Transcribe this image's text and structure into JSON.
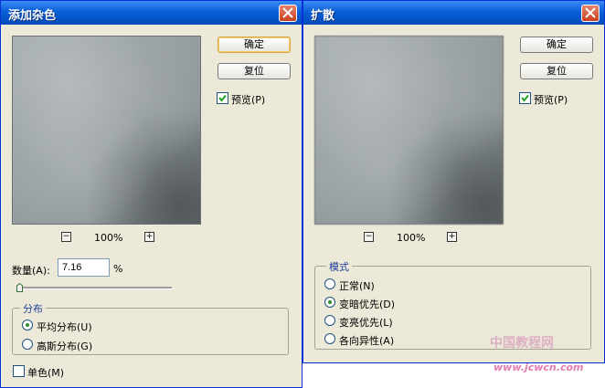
{
  "dialog1": {
    "title": "添加杂色",
    "buttons": {
      "ok": "确定",
      "reset": "复位"
    },
    "preview_label": "预览(P)",
    "preview_checked": true,
    "zoom": {
      "minus": "−",
      "value": "100%",
      "plus": "+"
    },
    "amount": {
      "label": "数量(A):",
      "value": "7.16",
      "unit": "%"
    },
    "distribution": {
      "title": "分布",
      "options": [
        "平均分布(U)",
        "高斯分布(G)"
      ],
      "selected": 0
    },
    "mono_label": "单色(M)",
    "mono_checked": false
  },
  "dialog2": {
    "title": "扩散",
    "buttons": {
      "ok": "确定",
      "reset": "复位"
    },
    "preview_label": "预览(P)",
    "preview_checked": true,
    "zoom": {
      "minus": "−",
      "value": "100%",
      "plus": "+"
    },
    "mode": {
      "title": "模式",
      "options": [
        "正常(N)",
        "变暗优先(D)",
        "变亮优先(L)",
        "各向异性(A)"
      ],
      "selected": 1
    }
  },
  "watermark": {
    "line1": "中国教程网",
    "line2": "www.jcwcn.com"
  },
  "colors": {
    "titlebar": "#0a5fd8",
    "dialog_bg": "#ece9d8",
    "group_title": "#1a3f99"
  }
}
